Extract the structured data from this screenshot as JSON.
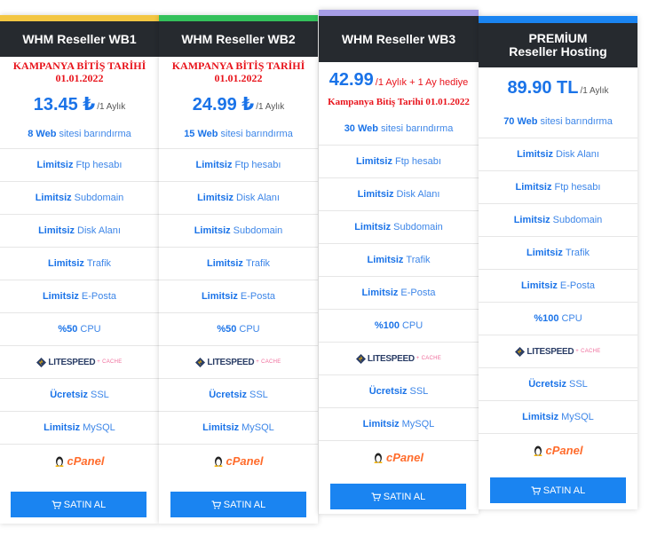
{
  "cards": [
    {
      "title": "WHM Reseller WB1",
      "accent": "#f3c642",
      "promo_line1": "KAMPANYA BİTİŞ TARİHİ",
      "promo_line2": "01.01.2022",
      "price": "13.45 ₺",
      "period": "/1 Aylık",
      "features": [
        {
          "bold": "8 Web",
          "text": "sitesi barındırma"
        },
        {
          "bold": "Limitsiz",
          "text": "Ftp hesabı"
        },
        {
          "bold": "Limitsiz",
          "text": "Subdomain"
        },
        {
          "bold": "Limitsiz",
          "text": "Disk Alanı"
        },
        {
          "bold": "Limitsiz",
          "text": "Trafik"
        },
        {
          "bold": "Limitsiz",
          "text": "E-Posta"
        },
        {
          "bold": "%50",
          "text": "CPU"
        },
        {
          "bold": "Ücretsiz",
          "text": "SSL"
        },
        {
          "bold": "Limitsiz",
          "text": "MySQL"
        }
      ],
      "button": "SATIN AL"
    },
    {
      "title": "WHM Reseller WB2",
      "accent": "#34c15b",
      "promo_line1": "KAMPANYA BİTİŞ TARİHİ",
      "promo_line2": "01.01.2022",
      "price": "24.99 ₺",
      "period": "/1 Aylık",
      "features": [
        {
          "bold": "15 Web",
          "text": "sitesi barındırma"
        },
        {
          "bold": "Limitsiz",
          "text": "Ftp hesabı"
        },
        {
          "bold": "Limitsiz",
          "text": "Disk Alanı"
        },
        {
          "bold": "Limitsiz",
          "text": "Subdomain"
        },
        {
          "bold": "Limitsiz",
          "text": "Trafik"
        },
        {
          "bold": "Limitsiz",
          "text": "E-Posta"
        },
        {
          "bold": "%50",
          "text": "CPU"
        },
        {
          "bold": "Ücretsiz",
          "text": "SSL"
        },
        {
          "bold": "Limitsiz",
          "text": "MySQL"
        }
      ],
      "button": "SATIN AL"
    },
    {
      "title": "WHM Reseller WB3",
      "accent": "#a79ee6",
      "price": "42.99",
      "period": "/1 Aylık + 1 Ay hediye",
      "promo_inline": "Kampanya Bitiş Tarihi 01.01.2022",
      "features": [
        {
          "bold": "30 Web",
          "text": "sitesi barındırma"
        },
        {
          "bold": "Limitsiz",
          "text": "Ftp hesabı"
        },
        {
          "bold": "Limitsiz",
          "text": "Disk Alanı"
        },
        {
          "bold": "Limitsiz",
          "text": "Subdomain"
        },
        {
          "bold": "Limitsiz",
          "text": "Trafik"
        },
        {
          "bold": "Limitsiz",
          "text": "E-Posta"
        },
        {
          "bold": "%100",
          "text": "CPU"
        },
        {
          "bold": "Ücretsiz",
          "text": "SSL"
        },
        {
          "bold": "Limitsiz",
          "text": "MySQL"
        }
      ],
      "button": "SATIN AL"
    },
    {
      "title": "PREMİUM Reseller Hosting",
      "accent": "#1a84f1",
      "price": "89.90 TL",
      "period": "/1 Aylık",
      "features": [
        {
          "bold": "70 Web",
          "text": "sitesi barındırma"
        },
        {
          "bold": "Limitsiz",
          "text": "Disk Alanı"
        },
        {
          "bold": "Limitsiz",
          "text": "Ftp hesabı"
        },
        {
          "bold": "Limitsiz",
          "text": "Subdomain"
        },
        {
          "bold": "Limitsiz",
          "text": "Trafik"
        },
        {
          "bold": "Limitsiz",
          "text": "E-Posta"
        },
        {
          "bold": "%100",
          "text": "CPU"
        },
        {
          "bold": "Ücretsiz",
          "text": "SSL"
        },
        {
          "bold": "Limitsiz",
          "text": "MySQL"
        }
      ],
      "button": "SATIN AL"
    }
  ],
  "logos": {
    "litespeed": "LITESPEED",
    "cache": "+ CACHE",
    "cpanel": "cPanel"
  },
  "icons": [
    "litespeed-logo-icon",
    "cpanel-logo-icon",
    "tux-icon",
    "cart-icon"
  ]
}
